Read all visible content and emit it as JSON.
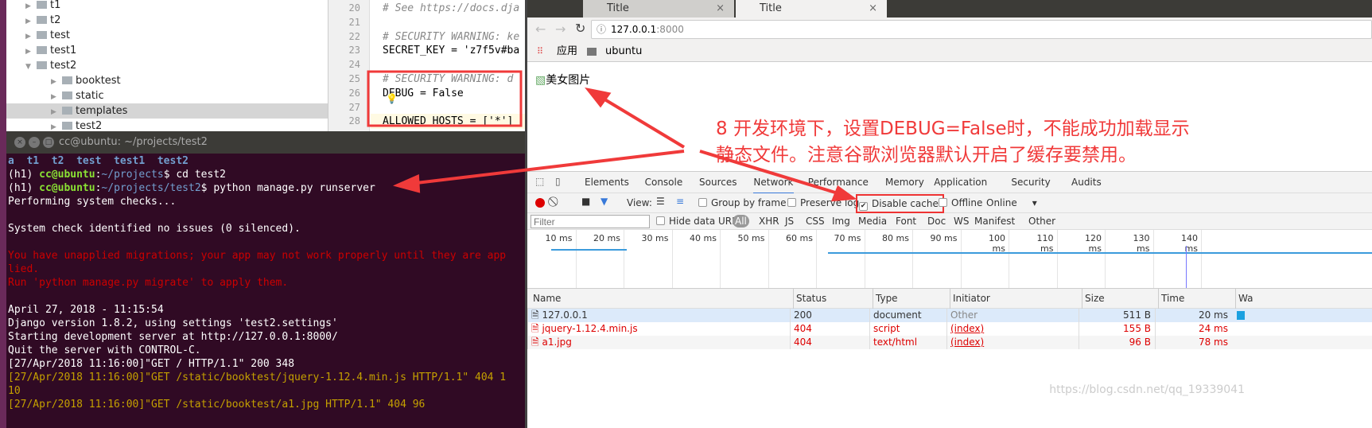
{
  "tree": {
    "items": [
      {
        "label": "t1",
        "open": false,
        "depth": 1
      },
      {
        "label": "t2",
        "open": false,
        "depth": 1
      },
      {
        "label": "test",
        "open": false,
        "depth": 1
      },
      {
        "label": "test1",
        "open": false,
        "depth": 1
      },
      {
        "label": "test2",
        "open": true,
        "depth": 1
      },
      {
        "label": "booktest",
        "open": false,
        "depth": 2
      },
      {
        "label": "static",
        "open": false,
        "depth": 2
      },
      {
        "label": "templates",
        "open": false,
        "depth": 2,
        "selected": true
      },
      {
        "label": "test2",
        "open": false,
        "depth": 2
      }
    ]
  },
  "editor": {
    "lines": [
      {
        "n": "20",
        "t": "# See https://docs.dja"
      },
      {
        "n": "21",
        "t": ""
      },
      {
        "n": "22",
        "t": "# SECURITY WARNING: ke"
      },
      {
        "n": "23",
        "t": "SECRET_KEY = 'z7f5v#ba"
      },
      {
        "n": "24",
        "t": ""
      },
      {
        "n": "25",
        "t": "# SECURITY WARNING: d"
      },
      {
        "n": "26",
        "t": "DEBUG = False"
      },
      {
        "n": "27",
        "t": ""
      },
      {
        "n": "28",
        "t": "ALLOWED_HOSTS = ['*']"
      },
      {
        "n": "29",
        "t": ""
      }
    ]
  },
  "terminal": {
    "title": "cc@ubuntu: ~/projects/test2",
    "ls": "a  t1  t2  test  test1  test2",
    "prompt1_user": "cc@ubuntu",
    "prompt1_path": "~/projects",
    "cmd1": "cd test2",
    "prompt2_path": "~/projects/test2",
    "cmd2": "python manage.py runserver",
    "env": "(h1) ",
    "lines": [
      "Performing system checks...",
      "",
      "System check identified no issues (0 silenced).",
      "",
      "You have unapplied migrations; your app may not work properly until they are app",
      "lied.",
      "Run 'python manage.py migrate' to apply them.",
      "",
      "April 27, 2018 - 11:15:54",
      "Django version 1.8.2, using settings 'test2.settings'",
      "Starting development server at http://127.0.0.1:8000/",
      "Quit the server with CONTROL-C.",
      "[27/Apr/2018 11:16:00]\"GET / HTTP/1.1\" 200 348",
      "[27/Apr/2018 11:16:00]\"GET /static/booktest/jquery-1.12.4.min.js HTTP/1.1\" 404 1",
      "10",
      "[27/Apr/2018 11:16:00]\"GET /static/booktest/a1.jpg HTTP/1.1\" 404 96"
    ],
    "line_colors": [
      "w",
      "w",
      "w",
      "w",
      "r",
      "r",
      "r",
      "w",
      "w",
      "w",
      "w",
      "w",
      "w",
      "y",
      "y",
      "y"
    ]
  },
  "browser": {
    "tabs": [
      "Title",
      "Title"
    ],
    "url_host": "127.0.0.1",
    "url_port": ":8000",
    "bookmarks": [
      "应用",
      "ubuntu"
    ],
    "img_alt": "美女图片"
  },
  "devtools": {
    "tabs": [
      "Elements",
      "Console",
      "Sources",
      "Network",
      "Performance",
      "Memory",
      "Application",
      "Security",
      "Audits"
    ],
    "active_tab": "Network",
    "view_label": "View:",
    "group_by_frame": "Group by frame",
    "preserve_log": "Preserve log",
    "disable_cache": "Disable cache",
    "offline": "Offline",
    "throttle": "Online",
    "filter_placeholder": "Filter",
    "hide_data_urls": "Hide data URLs",
    "filters": [
      "All",
      "XHR",
      "JS",
      "CSS",
      "Img",
      "Media",
      "Font",
      "Doc",
      "WS",
      "Manifest",
      "Other"
    ],
    "timeline_ticks": [
      "10 ms",
      "20 ms",
      "30 ms",
      "40 ms",
      "50 ms",
      "60 ms",
      "70 ms",
      "80 ms",
      "90 ms",
      "100 ms",
      "110 ms",
      "120 ms",
      "130 ms",
      "140 ms"
    ],
    "columns": [
      "Name",
      "Status",
      "Type",
      "Initiator",
      "Size",
      "Time",
      "Wa"
    ],
    "rows": [
      {
        "name": "127.0.0.1",
        "status": "200",
        "type": "document",
        "initiator": "Other",
        "size": "511 B",
        "time": "20 ms",
        "error": false
      },
      {
        "name": "jquery-1.12.4.min.js",
        "status": "404",
        "type": "script",
        "initiator": "(index)",
        "size": "155 B",
        "time": "24 ms",
        "error": true
      },
      {
        "name": "a1.jpg",
        "status": "404",
        "type": "text/html",
        "initiator": "(index)",
        "size": "96 B",
        "time": "78 ms",
        "error": true
      }
    ]
  },
  "annotation": {
    "line1": "8 开发环境下，设置DEBUG=False时，不能成功加载显示",
    "line2": "静态文件。注意谷歌浏览器默认开启了缓存要禁用。",
    "color": "#f03a3a"
  },
  "watermark": "https://blog.csdn.net/qq_19339041"
}
